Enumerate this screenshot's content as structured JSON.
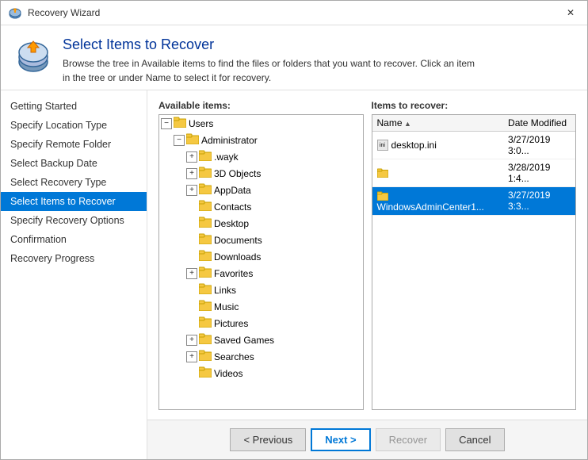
{
  "window": {
    "title": "Recovery Wizard",
    "close_label": "✕"
  },
  "wizard": {
    "header_title": "Select Items to Recover",
    "description_line1": "Browse the tree in Available items to find the files or folders that you want to recover. Click an item",
    "description_line2": "in the tree or under Name to select it for recovery."
  },
  "sidebar": {
    "items": [
      {
        "id": "getting-started",
        "label": "Getting Started",
        "active": false
      },
      {
        "id": "specify-location-type",
        "label": "Specify Location Type",
        "active": false
      },
      {
        "id": "specify-remote-folder",
        "label": "Specify Remote Folder",
        "active": false
      },
      {
        "id": "select-backup-date",
        "label": "Select Backup Date",
        "active": false
      },
      {
        "id": "select-recovery-type",
        "label": "Select Recovery Type",
        "active": false
      },
      {
        "id": "select-items-to-recover",
        "label": "Select Items to Recover",
        "active": true
      },
      {
        "id": "specify-recovery-options",
        "label": "Specify Recovery Options",
        "active": false
      },
      {
        "id": "confirmation",
        "label": "Confirmation",
        "active": false
      },
      {
        "id": "recovery-progress",
        "label": "Recovery Progress",
        "active": false
      }
    ]
  },
  "available_items_label": "Available items:",
  "items_to_recover_label": "Items to recover:",
  "tree": {
    "root": "Users",
    "children": [
      {
        "label": "Administrator",
        "expanded": true,
        "children": [
          {
            "label": ".wayk",
            "expanded": false
          },
          {
            "label": "3D Objects",
            "expanded": false
          },
          {
            "label": "AppData",
            "expanded": false
          },
          {
            "label": "Contacts",
            "expanded": false
          },
          {
            "label": "Desktop",
            "expanded": false
          },
          {
            "label": "Documents",
            "expanded": false
          },
          {
            "label": "Downloads",
            "expanded": false
          },
          {
            "label": "Favorites",
            "expanded": false
          },
          {
            "label": "Links",
            "expanded": false
          },
          {
            "label": "Music",
            "expanded": false
          },
          {
            "label": "Pictures",
            "expanded": false
          },
          {
            "label": "Saved Games",
            "expanded": false
          },
          {
            "label": "Searches",
            "expanded": false
          },
          {
            "label": "Videos",
            "expanded": false
          }
        ]
      }
    ]
  },
  "recover_table": {
    "columns": [
      {
        "id": "name",
        "label": "Name",
        "sort": true
      },
      {
        "id": "date_modified",
        "label": "Date Modified",
        "sort": false
      }
    ],
    "rows": [
      {
        "id": "row1",
        "name": "desktop.ini",
        "date": "3/27/2019 3:0...",
        "type": "file",
        "selected": false
      },
      {
        "id": "row2",
        "name": "",
        "date": "3/28/2019 1:4...",
        "type": "folder",
        "selected": false
      },
      {
        "id": "row3",
        "name": "WindowsAdminCenter1...",
        "date": "3/27/2019 3:3...",
        "type": "folder",
        "selected": true
      }
    ]
  },
  "footer": {
    "previous_label": "< Previous",
    "next_label": "Next >",
    "recover_label": "Recover",
    "cancel_label": "Cancel"
  },
  "colors": {
    "active_sidebar": "#0078d7",
    "selected_row": "#0078d7",
    "wizard_title": "#003399"
  }
}
